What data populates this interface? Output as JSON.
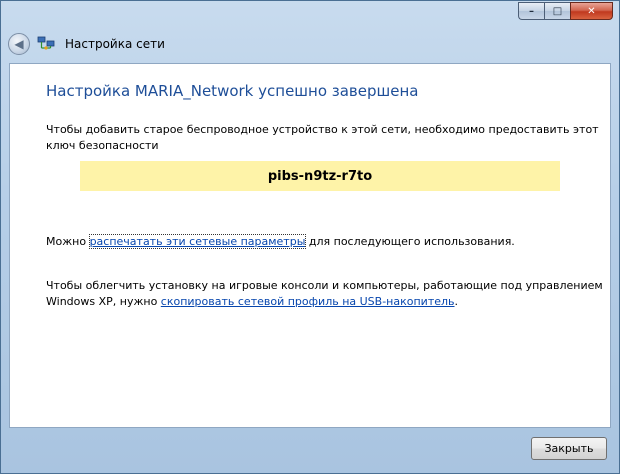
{
  "window": {
    "title": "Настройка сети",
    "caption": {
      "minimize": "–",
      "maximize": "□",
      "close": "✕"
    }
  },
  "content": {
    "heading": "Настройка MARIA_Network успешно завершена",
    "instruction": "Чтобы добавить старое беспроводное устройство к этой сети, необходимо предоставить этот ключ безопасности",
    "security_key": "pibs-n9tz-r7to",
    "print_prefix": "Можно ",
    "print_link": "распечатать эти сетевые параметры",
    "print_suffix": " для последующего использования.",
    "usb_prefix": "Чтобы облегчить установку на игровые консоли и компьютеры, работающие под управлением Windows XP, нужно ",
    "usb_link": "скопировать сетевой профиль на USB-накопитель",
    "usb_suffix": "."
  },
  "footer": {
    "close_label": "Закрыть"
  },
  "colors": {
    "heading": "#1e4e98",
    "link": "#0645ad",
    "key_background": "#fef3a8"
  },
  "icons": [
    "back-arrow-icon",
    "network-icon",
    "minimize-icon",
    "maximize-icon",
    "close-icon"
  ]
}
